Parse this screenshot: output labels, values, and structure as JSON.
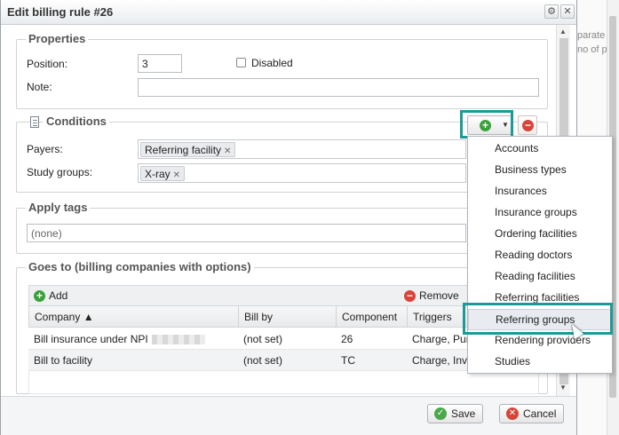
{
  "background": {
    "text_line1": "parate by",
    "text_line2": "no of pur"
  },
  "dialog": {
    "title": "Edit billing rule #26",
    "gear_symbol": "⚙",
    "close_symbol": "✕"
  },
  "properties": {
    "legend": "Properties",
    "position_label": "Position:",
    "position_value": "3",
    "disabled_label": "Disabled",
    "note_label": "Note:",
    "note_value": ""
  },
  "conditions": {
    "legend": "Conditions",
    "payers_label": "Payers:",
    "payers_tag": "Referring facility",
    "study_groups_label": "Study groups:",
    "study_groups_tag": "X-ray"
  },
  "apply_tags": {
    "legend": "Apply tags",
    "value": "(none)"
  },
  "goes_to": {
    "legend": "Goes to (billing companies with options)",
    "add_label": "Add",
    "remove_label": "Remove",
    "columns": [
      "Company ▲",
      "Bill by",
      "Component",
      "Triggers"
    ],
    "rows": [
      {
        "company": "Bill insurance under NPI",
        "bill_by": "(not set)",
        "component": "26",
        "triggers": "Charge, Pur"
      },
      {
        "company": "Bill to facility",
        "bill_by": "(not set)",
        "component": "TC",
        "triggers": "Charge, Inv"
      }
    ]
  },
  "footer": {
    "save_label": "Save",
    "cancel_label": "Cancel"
  },
  "menu": {
    "items": [
      "Accounts",
      "Business types",
      "Insurances",
      "Insurance groups",
      "Ordering facilities",
      "Reading doctors",
      "Reading facilities",
      "Referring facilities",
      "Referring groups",
      "Rendering providers",
      "Studies"
    ],
    "hovered": "Referring groups"
  },
  "colors": {
    "highlight": "#1a9a98",
    "add_green": "#3aa13a",
    "remove_red": "#d9433a"
  }
}
